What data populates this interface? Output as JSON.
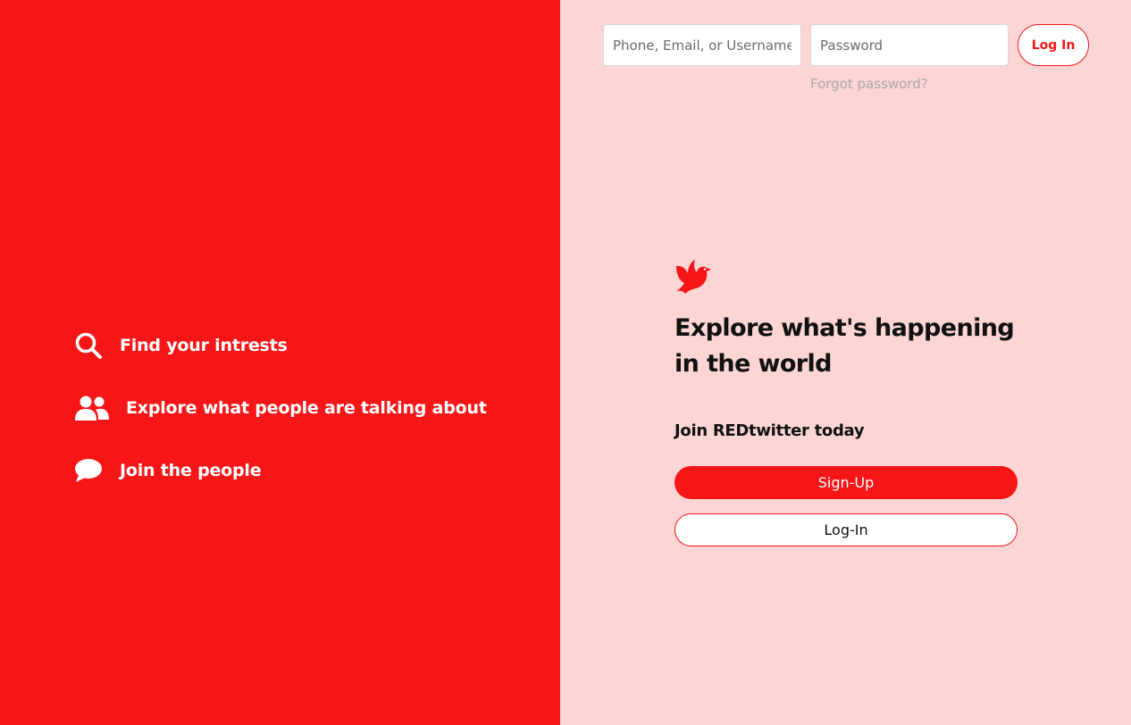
{
  "left_panel": {
    "features": [
      {
        "icon": "search-icon",
        "label": "Find your intrests"
      },
      {
        "icon": "users-icon",
        "label": "Explore what people are talking about"
      },
      {
        "icon": "chat-bubble-icon",
        "label": "Join the people"
      }
    ]
  },
  "login_bar": {
    "username_placeholder": "Phone, Email, or Username",
    "username_value": "",
    "password_placeholder": "Password",
    "password_value": "",
    "login_label": "Log In",
    "forgot_label": "Forgot password?"
  },
  "hero": {
    "logo_icon": "bird-logo-icon",
    "headline": "Explore what's happening in the world",
    "subheadline": "Join REDtwitter today",
    "signup_label": "Sign-Up",
    "login_label": "Log-In"
  },
  "colors": {
    "brand_red": "#f61617",
    "light_pink": "#fdd5d5",
    "white": "#ffffff"
  }
}
